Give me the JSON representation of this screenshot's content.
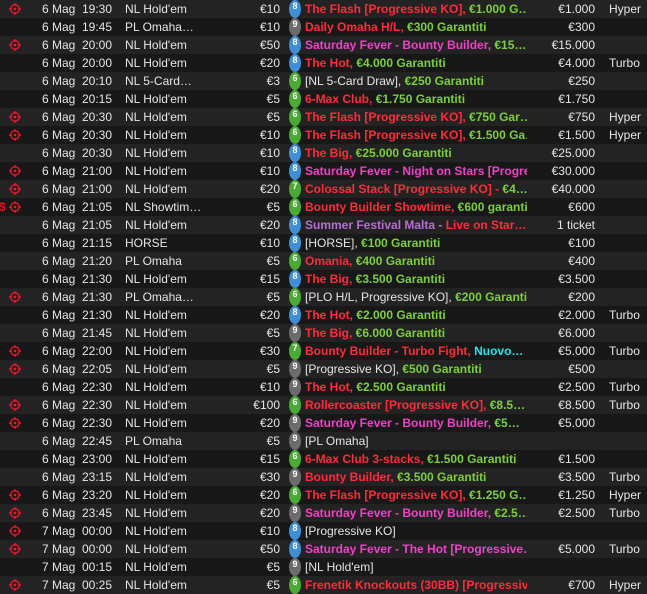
{
  "colors": {
    "red": "#ff2b3a",
    "pink": "#f040c8",
    "green": "#7ccf3a",
    "lime": "#86e041",
    "purple": "#b36fd0",
    "cyan": "#22e6ee",
    "white": "#e6e6e6",
    "badge_blue": "#3f8fd6",
    "badge_grey": "#6c6c6c",
    "badge_green": "#4aaa35",
    "target_red": "#e0192d"
  },
  "badge_colors": {
    "8": "#3f8fd6",
    "9": "#6c6c6c",
    "6": "#4aaa35",
    "7": "#4aaa35"
  },
  "tournaments": [
    {
      "date": "6 Mag",
      "time": "19:30",
      "game": "NL Hold'em",
      "buyin": "€10",
      "seats": "8",
      "target": true,
      "dollar": false,
      "name": [
        [
          "The Flash [Progressive KO], ",
          "red"
        ],
        [
          "€1.000 G…",
          "green"
        ]
      ],
      "prize": "€1.000",
      "type": "Hyper"
    },
    {
      "date": "6 Mag",
      "time": "19:45",
      "game": "PL Omaha…",
      "buyin": "€10",
      "seats": "9",
      "target": false,
      "dollar": false,
      "name": [
        [
          "Daily Omaha H/L, ",
          "red"
        ],
        [
          "€300 Garantiti",
          "green"
        ]
      ],
      "prize": "€300",
      "type": ""
    },
    {
      "date": "6 Mag",
      "time": "20:00",
      "game": "NL Hold'em",
      "buyin": "€50",
      "seats": "8",
      "target": true,
      "dollar": false,
      "name": [
        [
          "Saturday Fever - Bounty Builder, ",
          "pink"
        ],
        [
          "€15…",
          "green"
        ]
      ],
      "prize": "€15.000",
      "type": ""
    },
    {
      "date": "6 Mag",
      "time": "20:00",
      "game": "NL Hold'em",
      "buyin": "€20",
      "seats": "8",
      "target": false,
      "dollar": false,
      "name": [
        [
          "The Hot, ",
          "red"
        ],
        [
          "€4.000 Garantiti",
          "green"
        ]
      ],
      "prize": "€4.000",
      "type": "Turbo"
    },
    {
      "date": "6 Mag",
      "time": "20:10",
      "game": "NL 5-Card…",
      "buyin": "€3",
      "seats": "6",
      "target": false,
      "dollar": false,
      "name": [
        [
          "[NL 5-Card Draw], ",
          "white"
        ],
        [
          "€250 Garantiti",
          "green"
        ]
      ],
      "prize": "€250",
      "type": ""
    },
    {
      "date": "6 Mag",
      "time": "20:15",
      "game": "NL Hold'em",
      "buyin": "€5",
      "seats": "6",
      "target": false,
      "dollar": false,
      "name": [
        [
          "6-Max Club, ",
          "red"
        ],
        [
          "€1.750 Garantiti",
          "green"
        ]
      ],
      "prize": "€1.750",
      "type": ""
    },
    {
      "date": "6 Mag",
      "time": "20:30",
      "game": "NL Hold'em",
      "buyin": "€5",
      "seats": "6",
      "target": true,
      "dollar": false,
      "name": [
        [
          "The Flash [Progressive KO], ",
          "red"
        ],
        [
          "€750 Gar…",
          "green"
        ]
      ],
      "prize": "€750",
      "type": "Hyper"
    },
    {
      "date": "6 Mag",
      "time": "20:30",
      "game": "NL Hold'em",
      "buyin": "€10",
      "seats": "6",
      "target": true,
      "dollar": false,
      "name": [
        [
          "The Flash [Progressive KO], ",
          "red"
        ],
        [
          "€1.500 Ga…",
          "green"
        ]
      ],
      "prize": "€1.500",
      "type": "Hyper"
    },
    {
      "date": "6 Mag",
      "time": "20:30",
      "game": "NL Hold'em",
      "buyin": "€10",
      "seats": "8",
      "target": false,
      "dollar": false,
      "name": [
        [
          "The Big, ",
          "red"
        ],
        [
          "€25.000 Garantiti",
          "green"
        ]
      ],
      "prize": "€25.000",
      "type": ""
    },
    {
      "date": "6 Mag",
      "time": "21:00",
      "game": "NL Hold'em",
      "buyin": "€10",
      "seats": "8",
      "target": true,
      "dollar": false,
      "name": [
        [
          "Saturday Fever - Night on Stars [Progre…",
          "pink"
        ]
      ],
      "prize": "€30.000",
      "type": ""
    },
    {
      "date": "6 Mag",
      "time": "21:00",
      "game": "NL Hold'em",
      "buyin": "€20",
      "seats": "7",
      "target": true,
      "dollar": false,
      "name": [
        [
          "Colossal Stack [Progressive KO] - ",
          "red"
        ],
        [
          "€4…",
          "green"
        ]
      ],
      "prize": "€40.000",
      "type": ""
    },
    {
      "date": "6 Mag",
      "time": "21:05",
      "game": "NL Showtim…",
      "buyin": "€5",
      "seats": "6",
      "target": true,
      "dollar": true,
      "name": [
        [
          "Bounty Builder Showtime, ",
          "red"
        ],
        [
          "€600 garanti…",
          "green"
        ]
      ],
      "prize": "€600",
      "type": ""
    },
    {
      "date": "6 Mag",
      "time": "21:05",
      "game": "NL Hold'em",
      "buyin": "€20",
      "seats": "8",
      "target": false,
      "dollar": false,
      "name": [
        [
          "Summer Festival Malta - ",
          "purple"
        ],
        [
          "Live on Star…",
          "red"
        ]
      ],
      "prize": "1 ticket",
      "type": ""
    },
    {
      "date": "6 Mag",
      "time": "21:15",
      "game": "HORSE",
      "buyin": "€10",
      "seats": "8",
      "target": false,
      "dollar": false,
      "name": [
        [
          "[HORSE], ",
          "white"
        ],
        [
          "€100 Garantiti",
          "green"
        ]
      ],
      "prize": "€100",
      "type": ""
    },
    {
      "date": "6 Mag",
      "time": "21:20",
      "game": "PL Omaha",
      "buyin": "€5",
      "seats": "6",
      "target": false,
      "dollar": false,
      "name": [
        [
          "Omania, ",
          "red"
        ],
        [
          "€400 Garantiti",
          "green"
        ]
      ],
      "prize": "€400",
      "type": ""
    },
    {
      "date": "6 Mag",
      "time": "21:30",
      "game": "NL Hold'em",
      "buyin": "€15",
      "seats": "8",
      "target": false,
      "dollar": false,
      "name": [
        [
          "The Big, ",
          "red"
        ],
        [
          "€3.500 Garantiti",
          "green"
        ]
      ],
      "prize": "€3.500",
      "type": ""
    },
    {
      "date": "6 Mag",
      "time": "21:30",
      "game": "PL Omaha…",
      "buyin": "€5",
      "seats": "6",
      "target": true,
      "dollar": false,
      "name": [
        [
          "[PLO H/L, Progressive KO], ",
          "white"
        ],
        [
          "€200 Garantiti",
          "green"
        ]
      ],
      "prize": "€200",
      "type": ""
    },
    {
      "date": "6 Mag",
      "time": "21:30",
      "game": "NL Hold'em",
      "buyin": "€20",
      "seats": "8",
      "target": false,
      "dollar": false,
      "name": [
        [
          "The Hot, ",
          "red"
        ],
        [
          "€2.000 Garantiti",
          "green"
        ]
      ],
      "prize": "€2.000",
      "type": "Turbo"
    },
    {
      "date": "6 Mag",
      "time": "21:45",
      "game": "NL Hold'em",
      "buyin": "€5",
      "seats": "9",
      "target": false,
      "dollar": false,
      "name": [
        [
          "The Big, ",
          "red"
        ],
        [
          "€6.000 Garantiti",
          "green"
        ]
      ],
      "prize": "€6.000",
      "type": ""
    },
    {
      "date": "6 Mag",
      "time": "22:00",
      "game": "NL Hold'em",
      "buyin": "€30",
      "seats": "7",
      "target": true,
      "dollar": false,
      "name": [
        [
          "Bounty Builder - Turbo Fight, ",
          "red"
        ],
        [
          "Nuovo…",
          "cyan"
        ]
      ],
      "prize": "€5.000",
      "type": "Turbo"
    },
    {
      "date": "6 Mag",
      "time": "22:05",
      "game": "NL Hold'em",
      "buyin": "€5",
      "seats": "9",
      "target": true,
      "dollar": false,
      "name": [
        [
          "[Progressive KO], ",
          "white"
        ],
        [
          "€500 Garantiti",
          "green"
        ]
      ],
      "prize": "€500",
      "type": ""
    },
    {
      "date": "6 Mag",
      "time": "22:30",
      "game": "NL Hold'em",
      "buyin": "€10",
      "seats": "9",
      "target": false,
      "dollar": false,
      "name": [
        [
          "The Hot, ",
          "red"
        ],
        [
          "€2.500 Garantiti",
          "green"
        ]
      ],
      "prize": "€2.500",
      "type": "Turbo"
    },
    {
      "date": "6 Mag",
      "time": "22:30",
      "game": "NL Hold'em",
      "buyin": "€100",
      "seats": "6",
      "target": true,
      "dollar": false,
      "name": [
        [
          "Rollercoaster [Progressive KO], ",
          "red"
        ],
        [
          "€8.5…",
          "green"
        ]
      ],
      "prize": "€8.500",
      "type": "Turbo"
    },
    {
      "date": "6 Mag",
      "time": "22:30",
      "game": "NL Hold'em",
      "buyin": "€20",
      "seats": "9",
      "target": true,
      "dollar": false,
      "name": [
        [
          "Saturday Fever - Bounty Builder, ",
          "pink"
        ],
        [
          "€5…",
          "green"
        ]
      ],
      "prize": "€5.000",
      "type": ""
    },
    {
      "date": "6 Mag",
      "time": "22:45",
      "game": "PL Omaha",
      "buyin": "€5",
      "seats": "9",
      "target": false,
      "dollar": false,
      "name": [
        [
          "[PL Omaha]",
          "white"
        ]
      ],
      "prize": "",
      "type": ""
    },
    {
      "date": "6 Mag",
      "time": "23:00",
      "game": "NL Hold'em",
      "buyin": "€15",
      "seats": "6",
      "target": false,
      "dollar": false,
      "name": [
        [
          "6-Max Club 3-stacks, ",
          "red"
        ],
        [
          "€1.500 Garantiti",
          "green"
        ]
      ],
      "prize": "€1.500",
      "type": ""
    },
    {
      "date": "6 Mag",
      "time": "23:15",
      "game": "NL Hold'em",
      "buyin": "€30",
      "seats": "9",
      "target": false,
      "dollar": false,
      "name": [
        [
          "Bounty Builder, ",
          "red"
        ],
        [
          "€3.500 Garantiti",
          "green"
        ]
      ],
      "prize": "€3.500",
      "type": "Turbo"
    },
    {
      "date": "6 Mag",
      "time": "23:20",
      "game": "NL Hold'em",
      "buyin": "€20",
      "seats": "6",
      "target": true,
      "dollar": false,
      "name": [
        [
          "The Flash [Progressive KO], ",
          "red"
        ],
        [
          "€1.250 G…",
          "green"
        ]
      ],
      "prize": "€1.250",
      "type": "Hyper"
    },
    {
      "date": "6 Mag",
      "time": "23:45",
      "game": "NL Hold'em",
      "buyin": "€20",
      "seats": "9",
      "target": true,
      "dollar": false,
      "name": [
        [
          "Saturday Fever - Bounty Builder, ",
          "pink"
        ],
        [
          "€2.5…",
          "green"
        ]
      ],
      "prize": "€2.500",
      "type": "Turbo"
    },
    {
      "date": "7 Mag",
      "time": "00:00",
      "game": "NL Hold'em",
      "buyin": "€10",
      "seats": "8",
      "target": true,
      "dollar": false,
      "name": [
        [
          "[Progressive KO]",
          "white"
        ]
      ],
      "prize": "",
      "type": ""
    },
    {
      "date": "7 Mag",
      "time": "00:00",
      "game": "NL Hold'em",
      "buyin": "€50",
      "seats": "8",
      "target": true,
      "dollar": false,
      "name": [
        [
          "Saturday Fever - The Hot [Progressive…",
          "pink"
        ]
      ],
      "prize": "€5.000",
      "type": "Turbo"
    },
    {
      "date": "7 Mag",
      "time": "00:15",
      "game": "NL Hold'em",
      "buyin": "€5",
      "seats": "9",
      "target": false,
      "dollar": false,
      "name": [
        [
          "[NL Hold'em]",
          "white"
        ]
      ],
      "prize": "",
      "type": ""
    },
    {
      "date": "7 Mag",
      "time": "00:25",
      "game": "NL Hold'em",
      "buyin": "€5",
      "seats": "6",
      "target": true,
      "dollar": false,
      "name": [
        [
          "Frenetik Knockouts (30BB) [Progressive…",
          "red"
        ]
      ],
      "prize": "€700",
      "type": "Hyper"
    }
  ]
}
